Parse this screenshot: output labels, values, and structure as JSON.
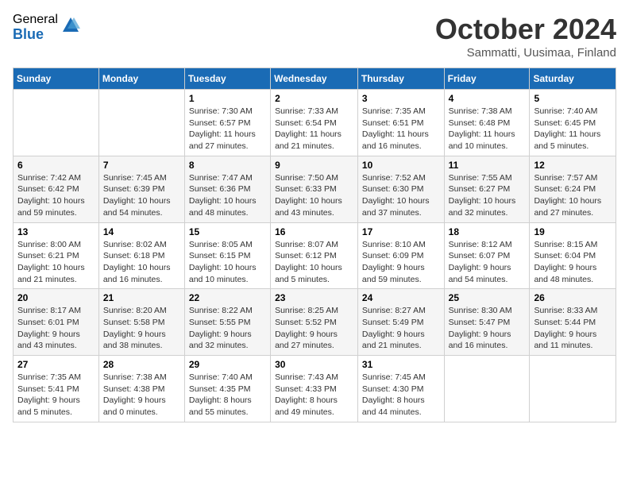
{
  "logo": {
    "general": "General",
    "blue": "Blue"
  },
  "header": {
    "month": "October 2024",
    "location": "Sammatti, Uusimaa, Finland"
  },
  "days_of_week": [
    "Sunday",
    "Monday",
    "Tuesday",
    "Wednesday",
    "Thursday",
    "Friday",
    "Saturday"
  ],
  "weeks": [
    [
      {
        "day": "",
        "details": ""
      },
      {
        "day": "",
        "details": ""
      },
      {
        "day": "1",
        "details": "Sunrise: 7:30 AM\nSunset: 6:57 PM\nDaylight: 11 hours\nand 27 minutes."
      },
      {
        "day": "2",
        "details": "Sunrise: 7:33 AM\nSunset: 6:54 PM\nDaylight: 11 hours\nand 21 minutes."
      },
      {
        "day": "3",
        "details": "Sunrise: 7:35 AM\nSunset: 6:51 PM\nDaylight: 11 hours\nand 16 minutes."
      },
      {
        "day": "4",
        "details": "Sunrise: 7:38 AM\nSunset: 6:48 PM\nDaylight: 11 hours\nand 10 minutes."
      },
      {
        "day": "5",
        "details": "Sunrise: 7:40 AM\nSunset: 6:45 PM\nDaylight: 11 hours\nand 5 minutes."
      }
    ],
    [
      {
        "day": "6",
        "details": "Sunrise: 7:42 AM\nSunset: 6:42 PM\nDaylight: 10 hours\nand 59 minutes."
      },
      {
        "day": "7",
        "details": "Sunrise: 7:45 AM\nSunset: 6:39 PM\nDaylight: 10 hours\nand 54 minutes."
      },
      {
        "day": "8",
        "details": "Sunrise: 7:47 AM\nSunset: 6:36 PM\nDaylight: 10 hours\nand 48 minutes."
      },
      {
        "day": "9",
        "details": "Sunrise: 7:50 AM\nSunset: 6:33 PM\nDaylight: 10 hours\nand 43 minutes."
      },
      {
        "day": "10",
        "details": "Sunrise: 7:52 AM\nSunset: 6:30 PM\nDaylight: 10 hours\nand 37 minutes."
      },
      {
        "day": "11",
        "details": "Sunrise: 7:55 AM\nSunset: 6:27 PM\nDaylight: 10 hours\nand 32 minutes."
      },
      {
        "day": "12",
        "details": "Sunrise: 7:57 AM\nSunset: 6:24 PM\nDaylight: 10 hours\nand 27 minutes."
      }
    ],
    [
      {
        "day": "13",
        "details": "Sunrise: 8:00 AM\nSunset: 6:21 PM\nDaylight: 10 hours\nand 21 minutes."
      },
      {
        "day": "14",
        "details": "Sunrise: 8:02 AM\nSunset: 6:18 PM\nDaylight: 10 hours\nand 16 minutes."
      },
      {
        "day": "15",
        "details": "Sunrise: 8:05 AM\nSunset: 6:15 PM\nDaylight: 10 hours\nand 10 minutes."
      },
      {
        "day": "16",
        "details": "Sunrise: 8:07 AM\nSunset: 6:12 PM\nDaylight: 10 hours\nand 5 minutes."
      },
      {
        "day": "17",
        "details": "Sunrise: 8:10 AM\nSunset: 6:09 PM\nDaylight: 9 hours\nand 59 minutes."
      },
      {
        "day": "18",
        "details": "Sunrise: 8:12 AM\nSunset: 6:07 PM\nDaylight: 9 hours\nand 54 minutes."
      },
      {
        "day": "19",
        "details": "Sunrise: 8:15 AM\nSunset: 6:04 PM\nDaylight: 9 hours\nand 48 minutes."
      }
    ],
    [
      {
        "day": "20",
        "details": "Sunrise: 8:17 AM\nSunset: 6:01 PM\nDaylight: 9 hours\nand 43 minutes."
      },
      {
        "day": "21",
        "details": "Sunrise: 8:20 AM\nSunset: 5:58 PM\nDaylight: 9 hours\nand 38 minutes."
      },
      {
        "day": "22",
        "details": "Sunrise: 8:22 AM\nSunset: 5:55 PM\nDaylight: 9 hours\nand 32 minutes."
      },
      {
        "day": "23",
        "details": "Sunrise: 8:25 AM\nSunset: 5:52 PM\nDaylight: 9 hours\nand 27 minutes."
      },
      {
        "day": "24",
        "details": "Sunrise: 8:27 AM\nSunset: 5:49 PM\nDaylight: 9 hours\nand 21 minutes."
      },
      {
        "day": "25",
        "details": "Sunrise: 8:30 AM\nSunset: 5:47 PM\nDaylight: 9 hours\nand 16 minutes."
      },
      {
        "day": "26",
        "details": "Sunrise: 8:33 AM\nSunset: 5:44 PM\nDaylight: 9 hours\nand 11 minutes."
      }
    ],
    [
      {
        "day": "27",
        "details": "Sunrise: 7:35 AM\nSunset: 5:41 PM\nDaylight: 9 hours\nand 5 minutes."
      },
      {
        "day": "28",
        "details": "Sunrise: 7:38 AM\nSunset: 4:38 PM\nDaylight: 9 hours\nand 0 minutes."
      },
      {
        "day": "29",
        "details": "Sunrise: 7:40 AM\nSunset: 4:35 PM\nDaylight: 8 hours\nand 55 minutes."
      },
      {
        "day": "30",
        "details": "Sunrise: 7:43 AM\nSunset: 4:33 PM\nDaylight: 8 hours\nand 49 minutes."
      },
      {
        "day": "31",
        "details": "Sunrise: 7:45 AM\nSunset: 4:30 PM\nDaylight: 8 hours\nand 44 minutes."
      },
      {
        "day": "",
        "details": ""
      },
      {
        "day": "",
        "details": ""
      }
    ]
  ]
}
